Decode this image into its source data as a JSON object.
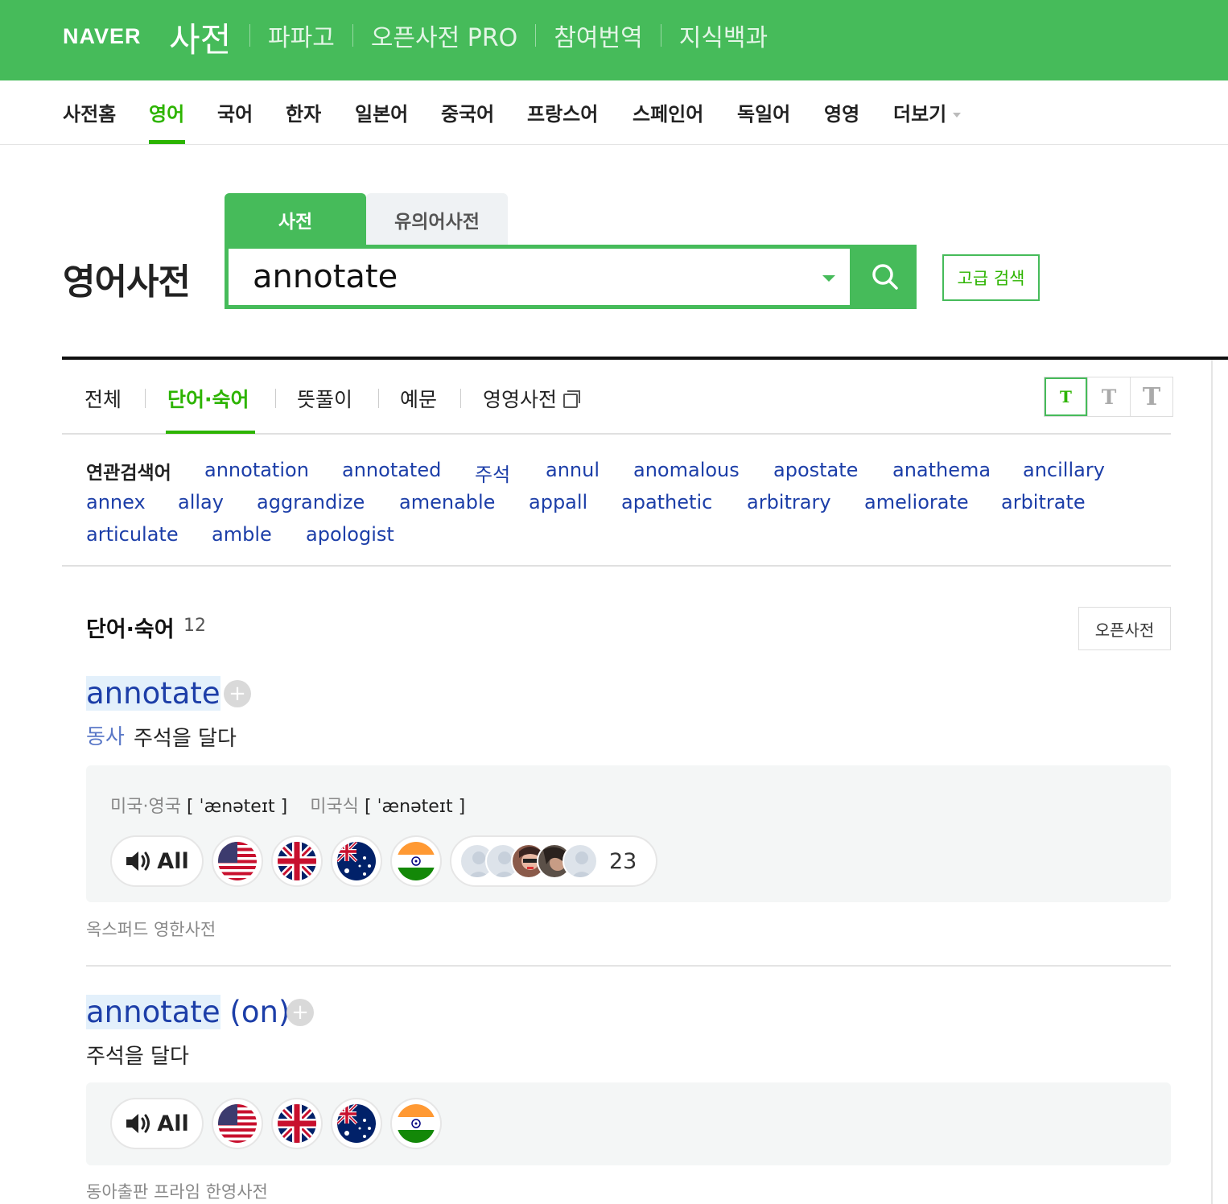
{
  "header": {
    "brand": "NAVER",
    "service": "사전",
    "nav": [
      "파파고",
      "오픈사전 PRO",
      "참여번역",
      "지식백과"
    ]
  },
  "lang_tabs": [
    "사전홈",
    "영어",
    "국어",
    "한자",
    "일본어",
    "중국어",
    "프랑스어",
    "스페인어",
    "독일어",
    "영영",
    "더보기"
  ],
  "lang_active": "영어",
  "search": {
    "title": "영어사전",
    "tabs": [
      "사전",
      "유의어사전"
    ],
    "query": "annotate",
    "advanced": "고급 검색"
  },
  "content_tabs": [
    "전체",
    "단어·숙어",
    "뜻풀이",
    "예문",
    "영영사전"
  ],
  "font_sizes": [
    "T",
    "T",
    "T"
  ],
  "related": {
    "label": "연관검색어",
    "terms": [
      "annotation",
      "annotated",
      "주석",
      "annul",
      "anomalous",
      "apostate",
      "anathema",
      "ancillary",
      "annex",
      "allay",
      "aggrandize",
      "amenable",
      "appall",
      "apathetic",
      "arbitrary",
      "ameliorate",
      "arbitrate",
      "articulate",
      "amble",
      "apologist"
    ]
  },
  "section": {
    "title": "단어·숙어",
    "count": "12",
    "open_dict": "오픈사전"
  },
  "entries": [
    {
      "word": "annotate",
      "suffix": "",
      "pos": "동사",
      "meaning": "주석을 달다",
      "pron_label_1": "미국·영국",
      "pron_1": "[ ˈænəteɪt ]",
      "pron_label_2": "미국식",
      "pron_2": "[ ˈænəteɪt ]",
      "audio_all": "All",
      "user_count": "23",
      "source": "옥스퍼드 영한사전"
    },
    {
      "word": "annotate",
      "suffix": " (on)",
      "pos": "",
      "meaning": "주석을 달다",
      "audio_all": "All",
      "source": "동아출판 프라임 한영사전"
    }
  ],
  "colors": {
    "brand_green": "#46bb5a",
    "active_green": "#2db400",
    "link_blue": "#1c3ea8"
  }
}
